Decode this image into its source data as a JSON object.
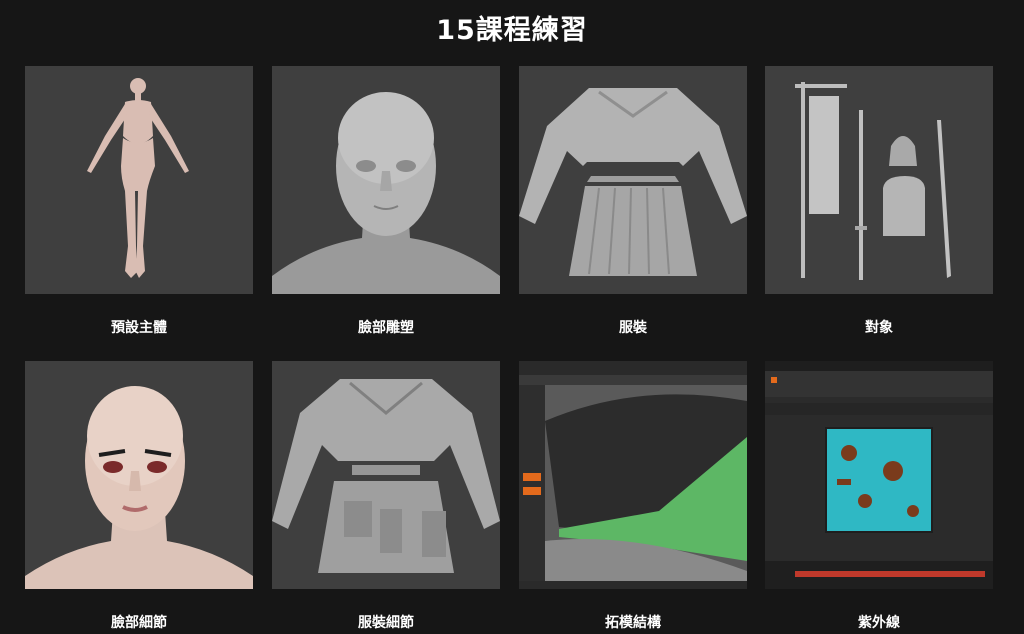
{
  "page": {
    "title": "15課程練習"
  },
  "lessons": [
    {
      "label": "預設主體",
      "icon": "base-body-model-icon"
    },
    {
      "label": "臉部雕塑",
      "icon": "face-sculpt-icon"
    },
    {
      "label": "服裝",
      "icon": "clothing-icon"
    },
    {
      "label": "對象",
      "icon": "props-objects-icon"
    },
    {
      "label": "臉部細節",
      "icon": "face-detail-icon"
    },
    {
      "label": "服裝細節",
      "icon": "clothing-detail-icon"
    },
    {
      "label": "拓模結構",
      "icon": "topology-icon"
    },
    {
      "label": "紫外線",
      "icon": "uv-layout-icon"
    }
  ],
  "colors": {
    "background": "#161616",
    "thumb_bg": "#3f3f3f",
    "text": "#ffffff",
    "uv_island": "#2fb8c4",
    "topology_green": "#5db765"
  }
}
